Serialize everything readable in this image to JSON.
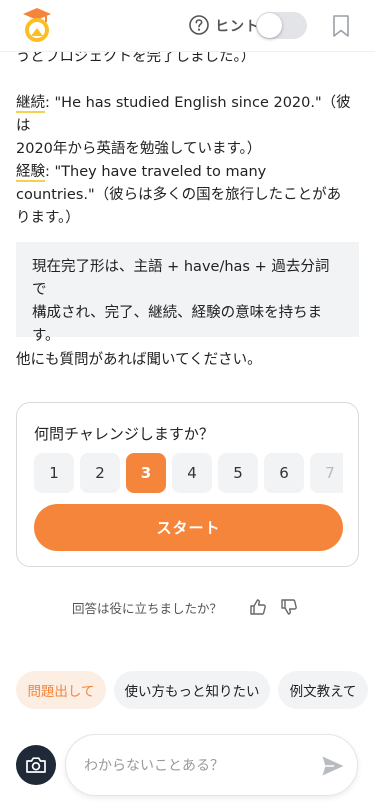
{
  "header": {
    "hint_label": "ヒント",
    "hint_toggle_on": false
  },
  "chat": {
    "line_top": "うどプロジェクトを完了しました。）",
    "continuation": {
      "term": "継続",
      "line1": ": \"He has studied English since 2020.\"（彼は",
      "line2": "2020年から英語を勉強しています。）"
    },
    "experience": {
      "term": "経験",
      "line1": ": \"They have traveled to many",
      "line2": "countries.\"（彼らは多くの国を旅行したことがあ",
      "line3": "ります。）"
    },
    "note": {
      "line1": "現在完了形は、主語 + have/has + 過去分詞で",
      "line2": "構成され、完了、継続、経験の意味を持ちま",
      "line3": "す。"
    },
    "closing": "他にも質問があれば聞いてください。"
  },
  "challenge": {
    "title": "何問チャレンジしますか？",
    "numbers": [
      "1",
      "2",
      "3",
      "4",
      "5",
      "6",
      "7"
    ],
    "selected": "3",
    "start_label": "スタート"
  },
  "feedback": {
    "question": "回答は役に立ちましたか？"
  },
  "suggestions": [
    "問題出して",
    "使い方もっと知りたい",
    "例文教えて"
  ],
  "input": {
    "placeholder": "わからないことある？"
  },
  "colors": {
    "accent": "#f5853a",
    "accent_light": "#fdeee4",
    "highlight_underline": "#f4d24f",
    "chip_bg": "#f2f3f5"
  }
}
